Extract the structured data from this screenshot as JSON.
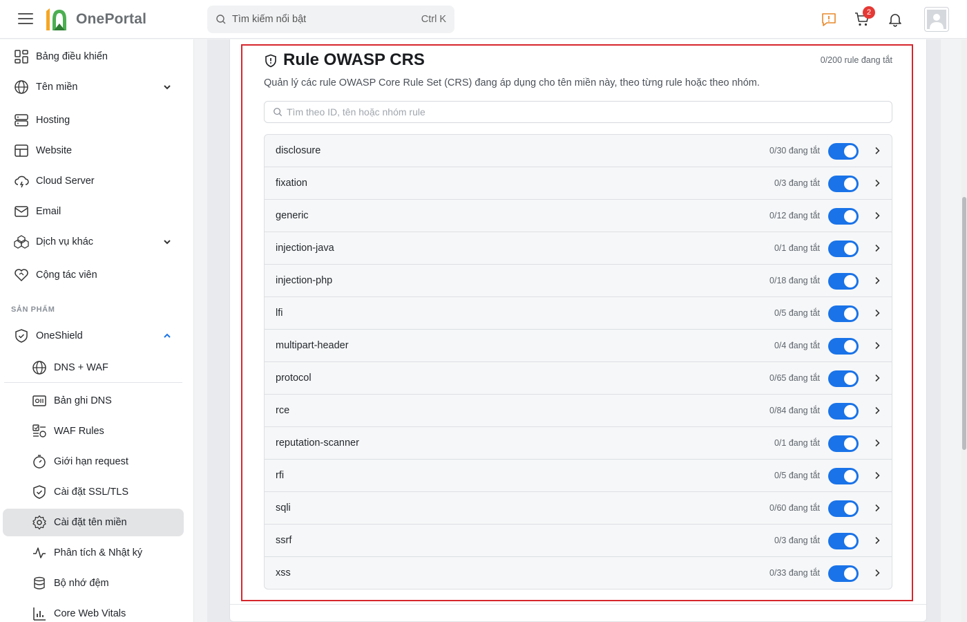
{
  "app": {
    "brand": "OnePortal"
  },
  "search": {
    "placeholder": "Tìm kiếm nổi bật",
    "shortcut": "Ctrl K"
  },
  "header": {
    "cart_count": "2"
  },
  "sidebar": {
    "items": [
      {
        "label": "Bảng điều khiển",
        "icon": "dashboard-icon"
      },
      {
        "label": "Tên miền",
        "icon": "globe-icon"
      },
      {
        "label": "Hosting",
        "icon": "server-icon"
      },
      {
        "label": "Website",
        "icon": "layout-icon"
      },
      {
        "label": "Cloud Server",
        "icon": "cloud-icon"
      },
      {
        "label": "Email",
        "icon": "mail-icon"
      },
      {
        "label": "Dịch vụ khác",
        "icon": "boxes-icon"
      },
      {
        "label": "Cộng tác viên",
        "icon": "handshake-icon"
      }
    ],
    "section_label": "SẢN PHẨM",
    "product": {
      "label": "OneShield",
      "icon": "shield-icon"
    },
    "sub_items": [
      {
        "label": "DNS + WAF",
        "icon": "globe-icon"
      },
      {
        "label": "Bản ghi DNS",
        "icon": "dns-record-icon"
      },
      {
        "label": "WAF Rules",
        "icon": "waf-rules-icon"
      },
      {
        "label": "Giới hạn request",
        "icon": "timer-icon"
      },
      {
        "label": "Cài đặt SSL/TLS",
        "icon": "shield-check-icon"
      },
      {
        "label": "Cài đặt tên miền",
        "icon": "gear-icon"
      },
      {
        "label": "Phân tích & Nhật ký",
        "icon": "activity-icon"
      },
      {
        "label": "Bộ nhớ đệm",
        "icon": "database-icon"
      },
      {
        "label": "Core Web Vitals",
        "icon": "bar-chart-icon"
      }
    ],
    "active": "Cài đặt tên miền"
  },
  "section": {
    "title": "Rule OWASP CRS",
    "count": "0/200 rule đang tắt",
    "description": "Quản lý các rule OWASP Core Rule Set (CRS) đang áp dụng cho tên miền này, theo từng rule hoặc theo nhóm.",
    "filter_placeholder": "Tìm theo ID, tên hoặc nhóm rule"
  },
  "groups": [
    {
      "name": "disclosure",
      "count": "0/30 đang tắt",
      "enabled": true
    },
    {
      "name": "fixation",
      "count": "0/3 đang tắt",
      "enabled": true
    },
    {
      "name": "generic",
      "count": "0/12 đang tắt",
      "enabled": true
    },
    {
      "name": "injection-java",
      "count": "0/1 đang tắt",
      "enabled": true
    },
    {
      "name": "injection-php",
      "count": "0/18 đang tắt",
      "enabled": true
    },
    {
      "name": "lfi",
      "count": "0/5 đang tắt",
      "enabled": true
    },
    {
      "name": "multipart-header",
      "count": "0/4 đang tắt",
      "enabled": true
    },
    {
      "name": "protocol",
      "count": "0/65 đang tắt",
      "enabled": true
    },
    {
      "name": "rce",
      "count": "0/84 đang tắt",
      "enabled": true
    },
    {
      "name": "reputation-scanner",
      "count": "0/1 đang tắt",
      "enabled": true
    },
    {
      "name": "rfi",
      "count": "0/5 đang tắt",
      "enabled": true
    },
    {
      "name": "sqli",
      "count": "0/60 đang tắt",
      "enabled": true
    },
    {
      "name": "ssrf",
      "count": "0/3 đang tắt",
      "enabled": true
    },
    {
      "name": "xss",
      "count": "0/33 đang tắt",
      "enabled": true
    }
  ],
  "colors": {
    "accent": "#1a73e8",
    "highlight": "#d6262c",
    "logo_orange": "#f5a623",
    "logo_green": "#4caf50",
    "badge": "#e53935"
  }
}
